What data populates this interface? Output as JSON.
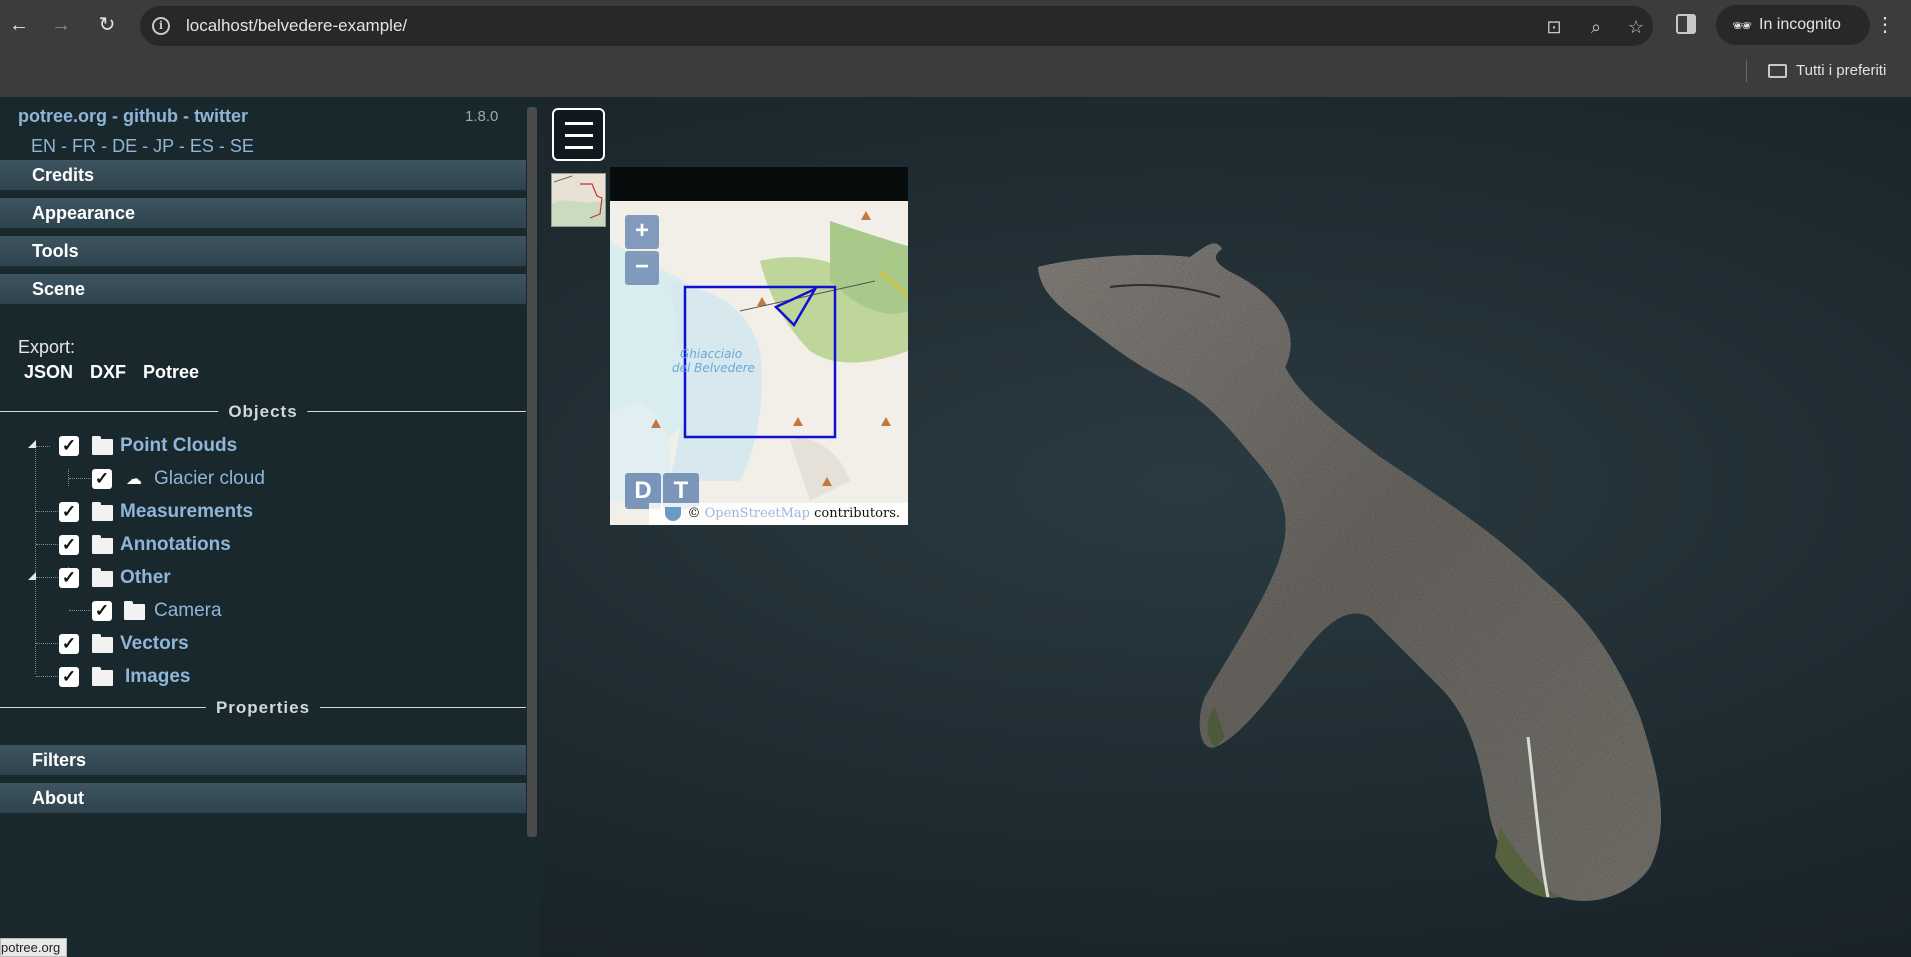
{
  "browser": {
    "url": "localhost/belvedere-example/",
    "incognito_label": "In incognito",
    "bookmarks_label": "Tutti i preferiti"
  },
  "sidebar": {
    "links": [
      "potree.org",
      "github",
      "twitter"
    ],
    "link_separator": "-",
    "version": "1.8.0",
    "languages": [
      "EN",
      "FR",
      "DE",
      "JP",
      "ES",
      "SE"
    ],
    "accordions_top": [
      "Credits",
      "Appearance",
      "Tools",
      "Scene"
    ],
    "export_label": "Export:",
    "export_buttons": [
      "JSON",
      "DXF",
      "Potree"
    ],
    "objects_title": "Objects",
    "tree": [
      {
        "label": "Point Clouds",
        "checked": true,
        "icon": "folder-icon",
        "level": 0,
        "expanded": true
      },
      {
        "label": "Glacier cloud",
        "checked": true,
        "icon": "cloud-icon",
        "level": 1
      },
      {
        "label": "Measurements",
        "checked": true,
        "icon": "folder-icon",
        "level": 0
      },
      {
        "label": "Annotations",
        "checked": true,
        "icon": "folder-icon",
        "level": 0
      },
      {
        "label": "Other",
        "checked": true,
        "icon": "folder-icon",
        "level": 0,
        "expanded": true
      },
      {
        "label": "Camera",
        "checked": true,
        "icon": "folder-icon",
        "level": 1
      },
      {
        "label": "Vectors",
        "checked": true,
        "icon": "folder-icon",
        "level": 0
      },
      {
        "label": "Images",
        "checked": true,
        "icon": "folder-icon",
        "level": 0
      }
    ],
    "properties_title": "Properties",
    "accordions_bottom": [
      "Filters",
      "About"
    ]
  },
  "minimap": {
    "zoom_in": "+",
    "zoom_out": "−",
    "label_line1": "Ghiacciaio",
    "label_line2": "del Belvedere",
    "mode_buttons": [
      "D",
      "T"
    ],
    "attribution_prefix": "©",
    "attribution_link": "OpenStreetMap",
    "attribution_suffix": "contributors."
  },
  "status_url": "potree.org",
  "colors": {
    "sidebar_bg": "#19282c",
    "link": "#8fb5d8",
    "accordion": "#3e5460",
    "extent_box": "#1010d0"
  }
}
